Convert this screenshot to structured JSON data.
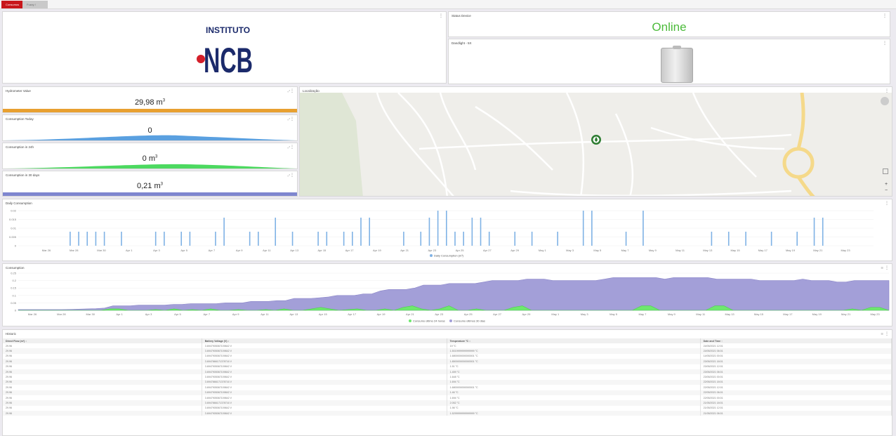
{
  "tabs": [
    "Consumos",
    "Fuzzy / Relige"
  ],
  "logo": {
    "top": "INSTITUTO",
    "main": "NCB"
  },
  "status_device": {
    "title": "Status Device",
    "value": "Online",
    "color": "#4cbb3b"
  },
  "device": {
    "title": "Dandlight - 5X"
  },
  "hydrometer": {
    "title": "Hydrometer Value",
    "value": "29,98",
    "unit": "m",
    "sup": "3",
    "color": "#e8a030"
  },
  "consumption_today": {
    "title": "Consumption Today",
    "value": "0",
    "color": "#5aa0e0"
  },
  "consumption_24h": {
    "title": "Consumption in 24h",
    "value": "0",
    "unit": "m",
    "sup": "3",
    "color": "#4cd960"
  },
  "consumption_30d": {
    "title": "Consumption in 30 days",
    "value": "0,21",
    "unit": "m",
    "sup": "3",
    "color": "#7f86cf"
  },
  "map": {
    "title": "Localização",
    "plus": "+",
    "minus": "−"
  },
  "daily": {
    "title": "Daily Consumption"
  },
  "consumption": {
    "title": "Consumption"
  },
  "historic": {
    "title": "Historic",
    "columns": [
      "Direct Flow (m³) ↕",
      "Battery Voltage (V) ↕",
      "Temperature °C ↕",
      "Date and Time ↑"
    ],
    "rows": [
      [
        "29.96",
        "3.6947905067109842 V",
        "19 °C",
        "24/05/2021 12:01"
      ],
      [
        "29.96",
        "3.6947905067109842 V",
        "1.5019999999999999 °C",
        "24/05/2021 06:01"
      ],
      [
        "29.96",
        "3.6947905067109842 V",
        "1.6800000000000001 °C",
        "14/05/2021 00:01"
      ],
      [
        "29.96",
        "3.6947866171378716 V",
        "1.8500000000000001 °C",
        "23/05/2021 18:01"
      ],
      [
        "29.96",
        "3.6947905067109842 V",
        "1.51 °C",
        "23/05/2021 12:01"
      ],
      [
        "29.96",
        "3.6947905067109842 V",
        "1.459 °C",
        "23/05/2021 06:01"
      ],
      [
        "29.96",
        "3.6947905067109842 V",
        "1.648 °C",
        "23/05/2021 00:01"
      ],
      [
        "29.96",
        "3.6947866171378716 V",
        "1.694 °C",
        "22/05/2021 18:01"
      ],
      [
        "29.96",
        "3.6947905067109842 V",
        "1.6800000000000001 °C",
        "22/05/2021 12:01"
      ],
      [
        "29.96",
        "3.6947905067109842 V",
        "1.46 °C",
        "22/05/2021 06:01"
      ],
      [
        "29.96",
        "3.6947905067109842 V",
        "1.694 °C",
        "22/05/2021 00:01"
      ],
      [
        "29.96",
        "3.6947866171378716 V",
        "2.052 °C",
        "21/05/2021 18:01"
      ],
      [
        "29.96",
        "3.6947905067109842 V",
        "1.98 °C",
        "21/05/2021 12:01"
      ],
      [
        "29.96",
        "3.6947905067109842 V",
        "1.5299999999999999 °C",
        "21/05/2021 06:01"
      ]
    ]
  },
  "chart_data": [
    {
      "type": "bar",
      "title": "Daily Consumption",
      "x_ticks": [
        "Mar 26",
        "Mar 28",
        "Mar 30",
        "Apr 1",
        "Apr 3",
        "Apr 5",
        "Apr 7",
        "Apr 9",
        "Apr 11",
        "Apr 13",
        "Apr 15",
        "Apr 17",
        "Apr 19",
        "Apr 21",
        "Apr 23",
        "Apr 25",
        "Apr 27",
        "Apr 29",
        "May 1",
        "May 3",
        "May 5",
        "May 7",
        "May 9",
        "May 11",
        "May 13",
        "May 15",
        "May 17",
        "May 19",
        "May 21",
        "May 23"
      ],
      "y_ticks": [
        "0.02",
        "0.015",
        "0.01",
        "0.005",
        "0"
      ],
      "ylim": [
        0,
        0.025
      ],
      "series": [
        {
          "name": "Daily Consumption (m³)",
          "color": "#7fb2e5"
        }
      ],
      "bars": [
        {
          "day": 6,
          "value": 0.01
        },
        {
          "day": 7,
          "value": 0.01
        },
        {
          "day": 8,
          "value": 0.01
        },
        {
          "day": 9,
          "value": 0.01
        },
        {
          "day": 10,
          "value": 0.01
        },
        {
          "day": 12,
          "value": 0.01
        },
        {
          "day": 16,
          "value": 0.01
        },
        {
          "day": 17,
          "value": 0.01
        },
        {
          "day": 19,
          "value": 0.01
        },
        {
          "day": 20,
          "value": 0.01
        },
        {
          "day": 23,
          "value": 0.01
        },
        {
          "day": 24,
          "value": 0.02
        },
        {
          "day": 27,
          "value": 0.01
        },
        {
          "day": 28,
          "value": 0.01
        },
        {
          "day": 30,
          "value": 0.02
        },
        {
          "day": 32,
          "value": 0.01
        },
        {
          "day": 35,
          "value": 0.01
        },
        {
          "day": 36,
          "value": 0.01
        },
        {
          "day": 38,
          "value": 0.01
        },
        {
          "day": 39,
          "value": 0.01
        },
        {
          "day": 40,
          "value": 0.02
        },
        {
          "day": 41,
          "value": 0.02
        },
        {
          "day": 45,
          "value": 0.01
        },
        {
          "day": 47,
          "value": 0.01
        },
        {
          "day": 48,
          "value": 0.02
        },
        {
          "day": 49,
          "value": 0.025
        },
        {
          "day": 50,
          "value": 0.025
        },
        {
          "day": 51,
          "value": 0.01
        },
        {
          "day": 52,
          "value": 0.01
        },
        {
          "day": 53,
          "value": 0.02
        },
        {
          "day": 54,
          "value": 0.02
        },
        {
          "day": 55,
          "value": 0.01
        },
        {
          "day": 58,
          "value": 0.01
        },
        {
          "day": 60,
          "value": 0.01
        },
        {
          "day": 63,
          "value": 0.01
        },
        {
          "day": 66,
          "value": 0.025
        },
        {
          "day": 67,
          "value": 0.025
        },
        {
          "day": 71,
          "value": 0.01
        },
        {
          "day": 73,
          "value": 0.025
        },
        {
          "day": 81,
          "value": 0.01
        },
        {
          "day": 83,
          "value": 0.01
        },
        {
          "day": 85,
          "value": 0.01
        },
        {
          "day": 88,
          "value": 0.01
        },
        {
          "day": 91,
          "value": 0.01
        },
        {
          "day": 93,
          "value": 0.02
        },
        {
          "day": 94,
          "value": 0.02
        }
      ]
    },
    {
      "type": "area",
      "title": "Consumption",
      "x_ticks": [
        "Mar 26",
        "Mar 28",
        "Mar 30",
        "Apr 1",
        "Apr 3",
        "Apr 5",
        "Apr 7",
        "Apr 9",
        "Apr 11",
        "Apr 13",
        "Apr 15",
        "Apr 17",
        "Apr 19",
        "Apr 21",
        "Apr 23",
        "Apr 25",
        "Apr 27",
        "Apr 29",
        "May 1",
        "May 3",
        "May 5",
        "May 7",
        "May 9",
        "May 11",
        "May 13",
        "May 15",
        "May 17",
        "May 19",
        "May 21",
        "May 23"
      ],
      "y_ticks": [
        "0.25",
        "0.2",
        "0.15",
        "0.1",
        "0.05",
        "0"
      ],
      "ylim": [
        0,
        0.25
      ],
      "series": [
        {
          "name": "Consumo último 24 horas",
          "color": "#6ee86e",
          "values": [
            0,
            0,
            0,
            0,
            0,
            0,
            0,
            0,
            0,
            0,
            0.01,
            0.01,
            0,
            0,
            0,
            0.005,
            0,
            0.01,
            0,
            0.005,
            0,
            0.01,
            0,
            0,
            0.005,
            0,
            0,
            0.005,
            0,
            0.01,
            0,
            0,
            0.01,
            0.02,
            0.01,
            0,
            0.005,
            0.01,
            0,
            0,
            0.01,
            0,
            0.02,
            0.03,
            0.01,
            0,
            0.01,
            0.03,
            0,
            0,
            0.01,
            0,
            0,
            0,
            0.02,
            0.03,
            0,
            0,
            0,
            0,
            0,
            0,
            0,
            0,
            0,
            0,
            0,
            0,
            0.03,
            0.03,
            0,
            0,
            0,
            0,
            0,
            0,
            0.03,
            0.03,
            0,
            0,
            0,
            0,
            0,
            0,
            0,
            0,
            0,
            0,
            0,
            0,
            0,
            0.01,
            0,
            0.02,
            0.02,
            0
          ]
        },
        {
          "name": "Consumo últimos 30 dias",
          "color": "#a39fd8",
          "values": [
            0.005,
            0.005,
            0.005,
            0.005,
            0.005,
            0.005,
            0.006,
            0.008,
            0.01,
            0.012,
            0.015,
            0.03,
            0.03,
            0.03,
            0.035,
            0.035,
            0.035,
            0.035,
            0.04,
            0.04,
            0.045,
            0.045,
            0.045,
            0.045,
            0.05,
            0.05,
            0.05,
            0.06,
            0.06,
            0.06,
            0.065,
            0.065,
            0.08,
            0.08,
            0.08,
            0.085,
            0.09,
            0.1,
            0.1,
            0.1,
            0.11,
            0.11,
            0.13,
            0.14,
            0.14,
            0.14,
            0.15,
            0.17,
            0.17,
            0.17,
            0.18,
            0.18,
            0.18,
            0.18,
            0.19,
            0.2,
            0.2,
            0.2,
            0.2,
            0.21,
            0.21,
            0.21,
            0.2,
            0.2,
            0.2,
            0.2,
            0.2,
            0.2,
            0.21,
            0.22,
            0.22,
            0.22,
            0.22,
            0.22,
            0.22,
            0.21,
            0.22,
            0.22,
            0.22,
            0.22,
            0.22,
            0.21,
            0.21,
            0.21,
            0.21,
            0.21,
            0.2,
            0.2,
            0.2,
            0.2,
            0.2,
            0.21,
            0.2,
            0.2,
            0.2,
            0.19,
            0.19,
            0.2,
            0.2,
            0.2,
            0.2,
            0.2
          ]
        }
      ]
    }
  ]
}
